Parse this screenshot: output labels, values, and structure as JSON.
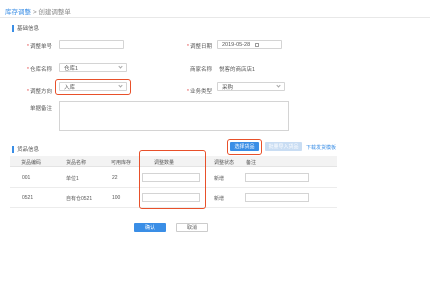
{
  "breadcrumb": {
    "parent": "库存调整",
    "separator": ">",
    "current": "创建调整单"
  },
  "basic_section": {
    "title": "基础信息"
  },
  "form": {
    "adjust_no": {
      "label": "调整单号",
      "value": ""
    },
    "adjust_date": {
      "label": "调整日期",
      "value": "2019-05-28"
    },
    "warehouse": {
      "label": "仓库名称",
      "value": "仓库1"
    },
    "merchant": {
      "label": "商家名称",
      "value": "悦客的商店店1"
    },
    "direction": {
      "label": "调整方向",
      "value": "入库"
    },
    "biz_type": {
      "label": "业务类型",
      "value": "采购"
    },
    "remark": {
      "label": "单据备注",
      "value": ""
    }
  },
  "goods_section": {
    "title": "货品信息",
    "select_button": "选择货品",
    "batch_import_button": "批量导入货品",
    "download_link": "下载发货模板"
  },
  "table": {
    "headers": [
      "货品编码",
      "货品名称",
      "可用库存",
      "调整数量",
      "调整状态",
      "备注"
    ],
    "rows": [
      {
        "code": "001",
        "name": "单位1",
        "stock": "22",
        "qty": "",
        "status": "新增",
        "note": ""
      },
      {
        "code": "0521",
        "name": "自有仓0521",
        "stock": "100",
        "qty": "",
        "status": "新增",
        "note": ""
      }
    ]
  },
  "footer": {
    "confirm": "确认",
    "cancel": "取消"
  },
  "colors": {
    "accent": "#3a8ee6",
    "highlight": "#e8502a",
    "required": "#e34d4d"
  }
}
